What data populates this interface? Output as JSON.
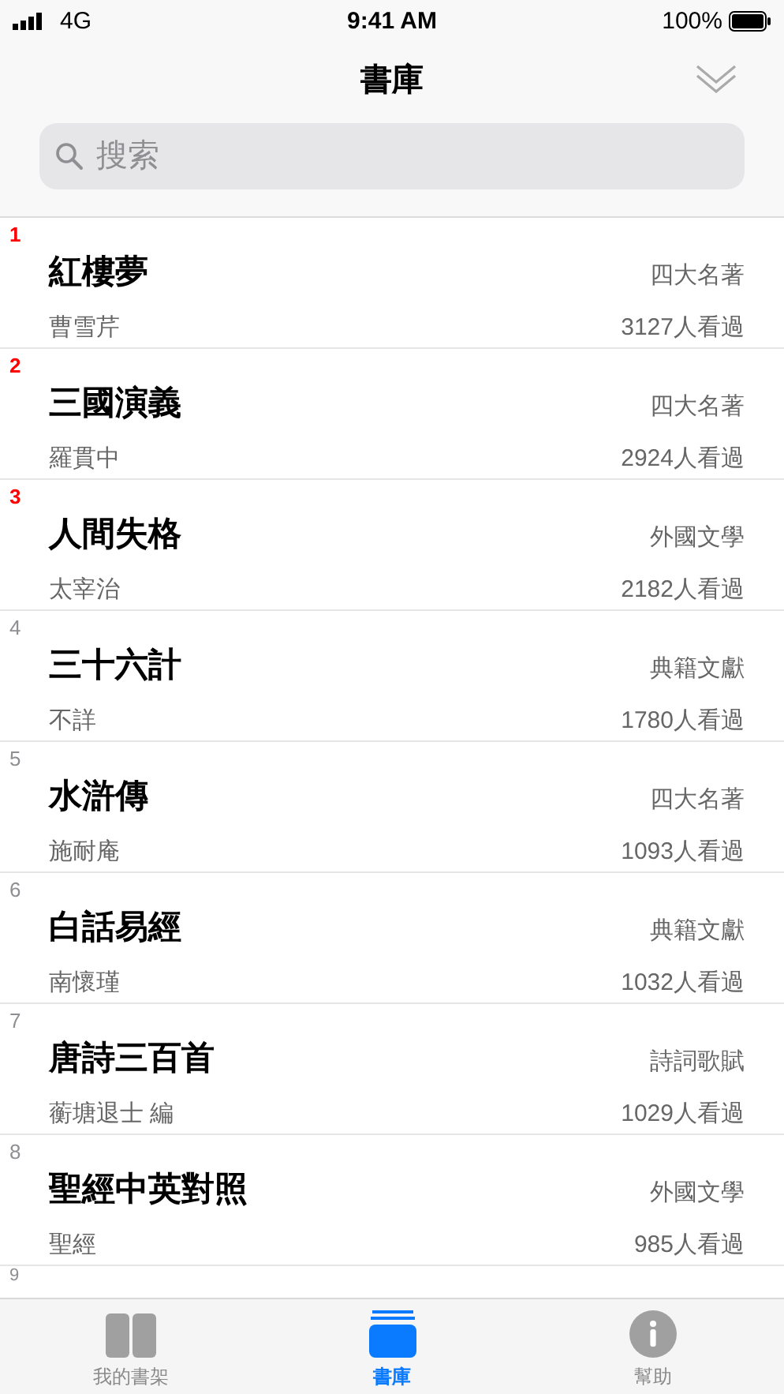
{
  "status_bar": {
    "carrier": "4G",
    "time": "9:41 AM",
    "battery": "100%"
  },
  "nav": {
    "title": "書庫"
  },
  "search": {
    "placeholder": "搜索"
  },
  "books": [
    {
      "rank": "1",
      "color": "#ff0000",
      "title": "紅樓夢",
      "author": "曹雪芹",
      "category": "四大名著",
      "views": "3127人看過"
    },
    {
      "rank": "2",
      "color": "#ff0000",
      "title": "三國演義",
      "author": "羅貫中",
      "category": "四大名著",
      "views": "2924人看過"
    },
    {
      "rank": "3",
      "color": "#ff0000",
      "title": "人間失格",
      "author": "太宰治",
      "category": "外國文學",
      "views": "2182人看過"
    },
    {
      "rank": "4",
      "color": "#8e8e93",
      "title": "三十六計",
      "author": "不詳",
      "category": "典籍文獻",
      "views": "1780人看過"
    },
    {
      "rank": "5",
      "color": "#8e8e93",
      "title": "水滸傳",
      "author": "施耐庵",
      "category": "四大名著",
      "views": "1093人看過"
    },
    {
      "rank": "6",
      "color": "#8e8e93",
      "title": "白話易經",
      "author": "南懷瑾",
      "category": "典籍文獻",
      "views": "1032人看過"
    },
    {
      "rank": "7",
      "color": "#8e8e93",
      "title": "唐詩三百首",
      "author": "蘅塘退士 編",
      "category": "詩詞歌賦",
      "views": "1029人看過"
    },
    {
      "rank": "8",
      "color": "#8e8e93",
      "title": "聖經中英對照",
      "author": "聖經",
      "category": "外國文學",
      "views": "985人看過"
    }
  ],
  "partial_rank": "9",
  "tabs": [
    {
      "kind": "book",
      "label": "我的書架",
      "selected": false
    },
    {
      "kind": "stack",
      "label": "書庫",
      "selected": true
    },
    {
      "kind": "info",
      "label": "幫助",
      "selected": false
    }
  ]
}
